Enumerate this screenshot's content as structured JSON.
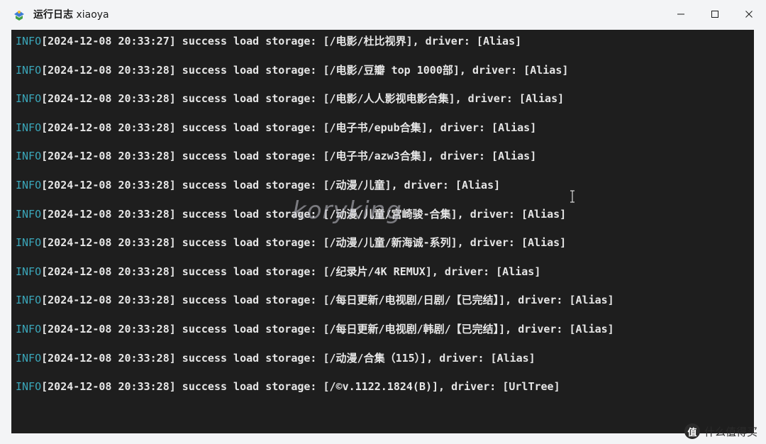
{
  "window": {
    "title_app": "运行日志",
    "title_name": "xiaoya"
  },
  "log": [
    {
      "level": "INFO",
      "text": "[2024-12-08 20:33:27] success load storage: [/电影/杜比视界], driver: [Alias]"
    },
    {
      "level": "INFO",
      "text": "[2024-12-08 20:33:28] success load storage: [/电影/豆瓣 top 1000部], driver: [Alias]"
    },
    {
      "level": "INFO",
      "text": "[2024-12-08 20:33:28] success load storage: [/电影/人人影视电影合集], driver: [Alias]"
    },
    {
      "level": "INFO",
      "text": "[2024-12-08 20:33:28] success load storage: [/电子书/epub合集], driver: [Alias]"
    },
    {
      "level": "INFO",
      "text": "[2024-12-08 20:33:28] success load storage: [/电子书/azw3合集], driver: [Alias]"
    },
    {
      "level": "INFO",
      "text": "[2024-12-08 20:33:28] success load storage: [/动漫/儿童], driver: [Alias]"
    },
    {
      "level": "INFO",
      "text": "[2024-12-08 20:33:28] success load storage: [/动漫/儿童/宫崎骏-合集], driver: [Alias]"
    },
    {
      "level": "INFO",
      "text": "[2024-12-08 20:33:28] success load storage: [/动漫/儿童/新海诚-系列], driver: [Alias]"
    },
    {
      "level": "INFO",
      "text": "[2024-12-08 20:33:28] success load storage: [/纪录片/4K REMUX], driver: [Alias]"
    },
    {
      "level": "INFO",
      "text": "[2024-12-08 20:33:28] success load storage: [/每日更新/电视剧/日剧/【已完结】], driver: [Alias]"
    },
    {
      "level": "INFO",
      "text": "[2024-12-08 20:33:28] success load storage: [/每日更新/电视剧/韩剧/【已完结】], driver: [Alias]"
    },
    {
      "level": "INFO",
      "text": "[2024-12-08 20:33:28] success load storage: [/动漫/合集（115）], driver: [Alias]"
    },
    {
      "level": "INFO",
      "text": "[2024-12-08 20:33:28] success load storage: [/©v.1122.1824(B)], driver: [UrlTree]"
    }
  ],
  "watermark": "koryking",
  "brand": {
    "badge": "值",
    "text": "什么值得买"
  },
  "colors": {
    "terminal_bg": "#1e1e1e",
    "info_level": "#3aa6b9",
    "text": "#e6e6e6"
  },
  "icons": {
    "app": "app-icon",
    "minimize": "minimize-icon",
    "maximize": "maximize-icon",
    "close": "close-icon",
    "cursor": "text-cursor-icon"
  }
}
